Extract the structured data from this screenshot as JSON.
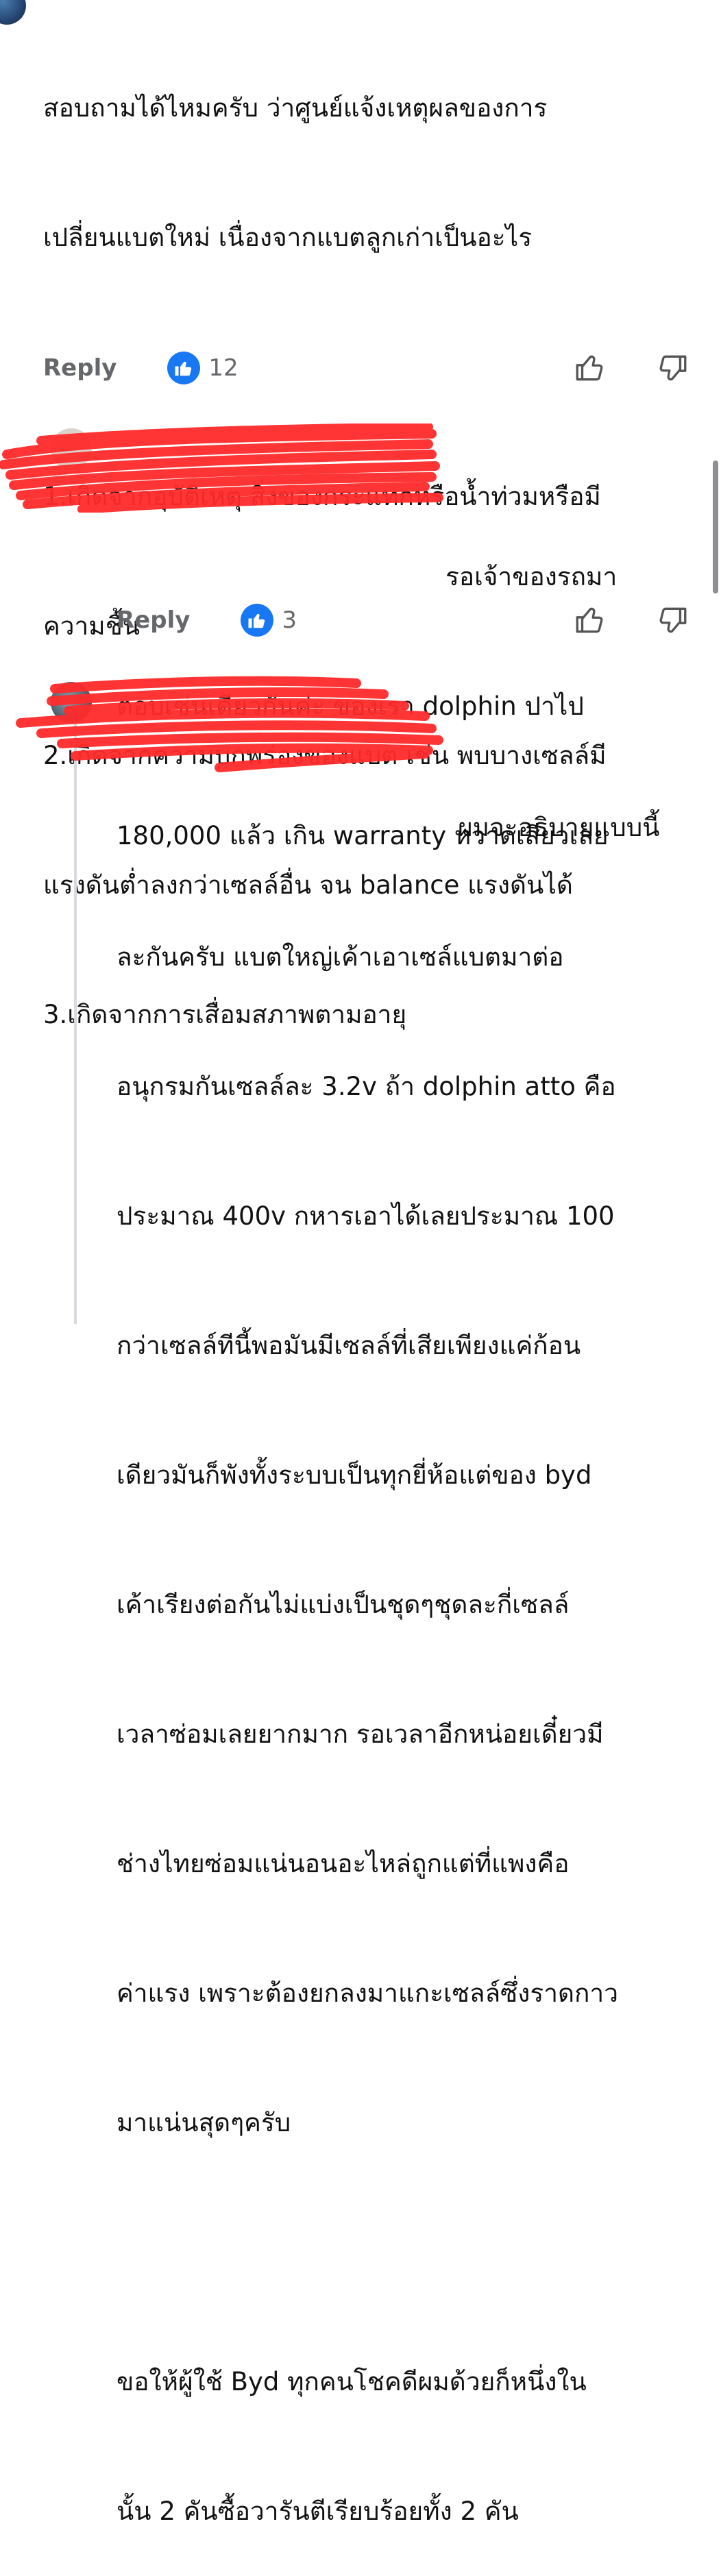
{
  "comments": [
    {
      "lines": [
        "สอบถามได้ไหมครับ ว่าศูนย์แจ้งเหตุผลของการ",
        "เปลี่ยนแบตใหม่ เนื่องจากแบตลูกเก่าเป็นอะไร",
        "",
        "1.เกิดจากอุบัติเหตุ สิ่งของกระแทกหรือน้ำท่วมหรือมี",
        "ความชื้น",
        "2.เกิดจากความบกพร่องของแบต เช่น พบบางเซลล์มี",
        "แรงดันต่ำลงกว่าเซลล์อื่น จน balance แรงดันได้",
        "3.เกิดจากการเสื่อมสภาพตามอายุ"
      ],
      "reply_label": "Reply",
      "like_count": "12"
    },
    {
      "lines": [
        "รอเจ้าของรถมา",
        "ตอบเช่นเดียวกันค่ะ ของเรา dolphin ปาไป",
        "180,000 แล้ว เกิน warranty หวาดเสียวเลย"
      ],
      "reply_label": "Reply",
      "like_count": "3"
    },
    {
      "lines": [
        "ผมจะอธิบายแบบนี้",
        "ละกันครับ แบตใหญ่เค้าเอาเซล์แบตมาต่อ",
        "อนุกรมกันเซลล์ละ 3.2v ถ้า dolphin atto คือ",
        "ประมาณ 400v กหารเอาได้เลยประมาณ 100",
        "กว่าเซลล์ทีนี้พอมันมีเซลล์ที่เสียเพียงแค่ก้อน",
        "เดียวมันก็พังทั้งระบบเป็นทุกยี่ห้อแต่ของ byd",
        "เค้าเรียงต่อกันไม่แบ่งเป็นชุดๆชุดละกี่เซลล์",
        "เวลาซ่อมเลยยากมาก รอเวลาอีกหน่อยเดี๋ยวมี",
        "ช่างไทยซ่อมแน่นอนอะไหล่ถูกแต่ที่แพงคือ",
        "ค่าแรง เพราะต้องยกลงมาแกะเซลล์ซึ่งราดกาว",
        "มาแน่นสุดๆครับ",
        "",
        "ขอให้ผู้ใช้ Byd ทุกคนโชคดีผมด้วยก็หนึ่งใน",
        "นั้น 2 คันซื้อวารันตีเรียบร้อยทั้ง 2 คัน"
      ]
    }
  ],
  "colors": {
    "like_blue": "#1877f2",
    "meta_gray": "#65676b",
    "redaction_red": "#ff2b2b"
  },
  "icons": [
    "like-badge-icon",
    "thumbs-up-icon",
    "thumbs-down-icon"
  ]
}
